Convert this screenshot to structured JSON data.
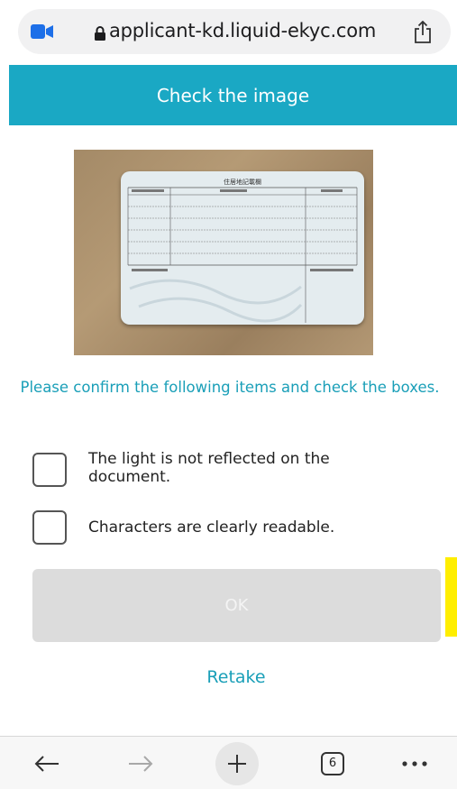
{
  "browser": {
    "url": "applicant-kd.liquid-ekyc.com",
    "camera_icon": "video-camera-icon",
    "lock_icon": "lock-icon",
    "share_icon": "share-icon",
    "accent_color": "#1d6fe8"
  },
  "header": {
    "title": "Check the image",
    "color": "#1aa8c4"
  },
  "document_image": {
    "card_title": "住居地記載欄"
  },
  "instruction": "Please confirm the following items and check the boxes.",
  "checklist": [
    {
      "label": "The light is not reflected on the document.",
      "checked": false
    },
    {
      "label": "Characters are clearly readable.",
      "checked": false
    }
  ],
  "buttons": {
    "ok_label": "OK",
    "ok_disabled": true,
    "retake_label": "Retake"
  },
  "toolbar": {
    "back_icon": "back-arrow-icon",
    "forward_icon": "forward-arrow-icon",
    "new_tab_icon": "plus-icon",
    "tab_count": "6",
    "more_icon": "more-dots-icon"
  }
}
